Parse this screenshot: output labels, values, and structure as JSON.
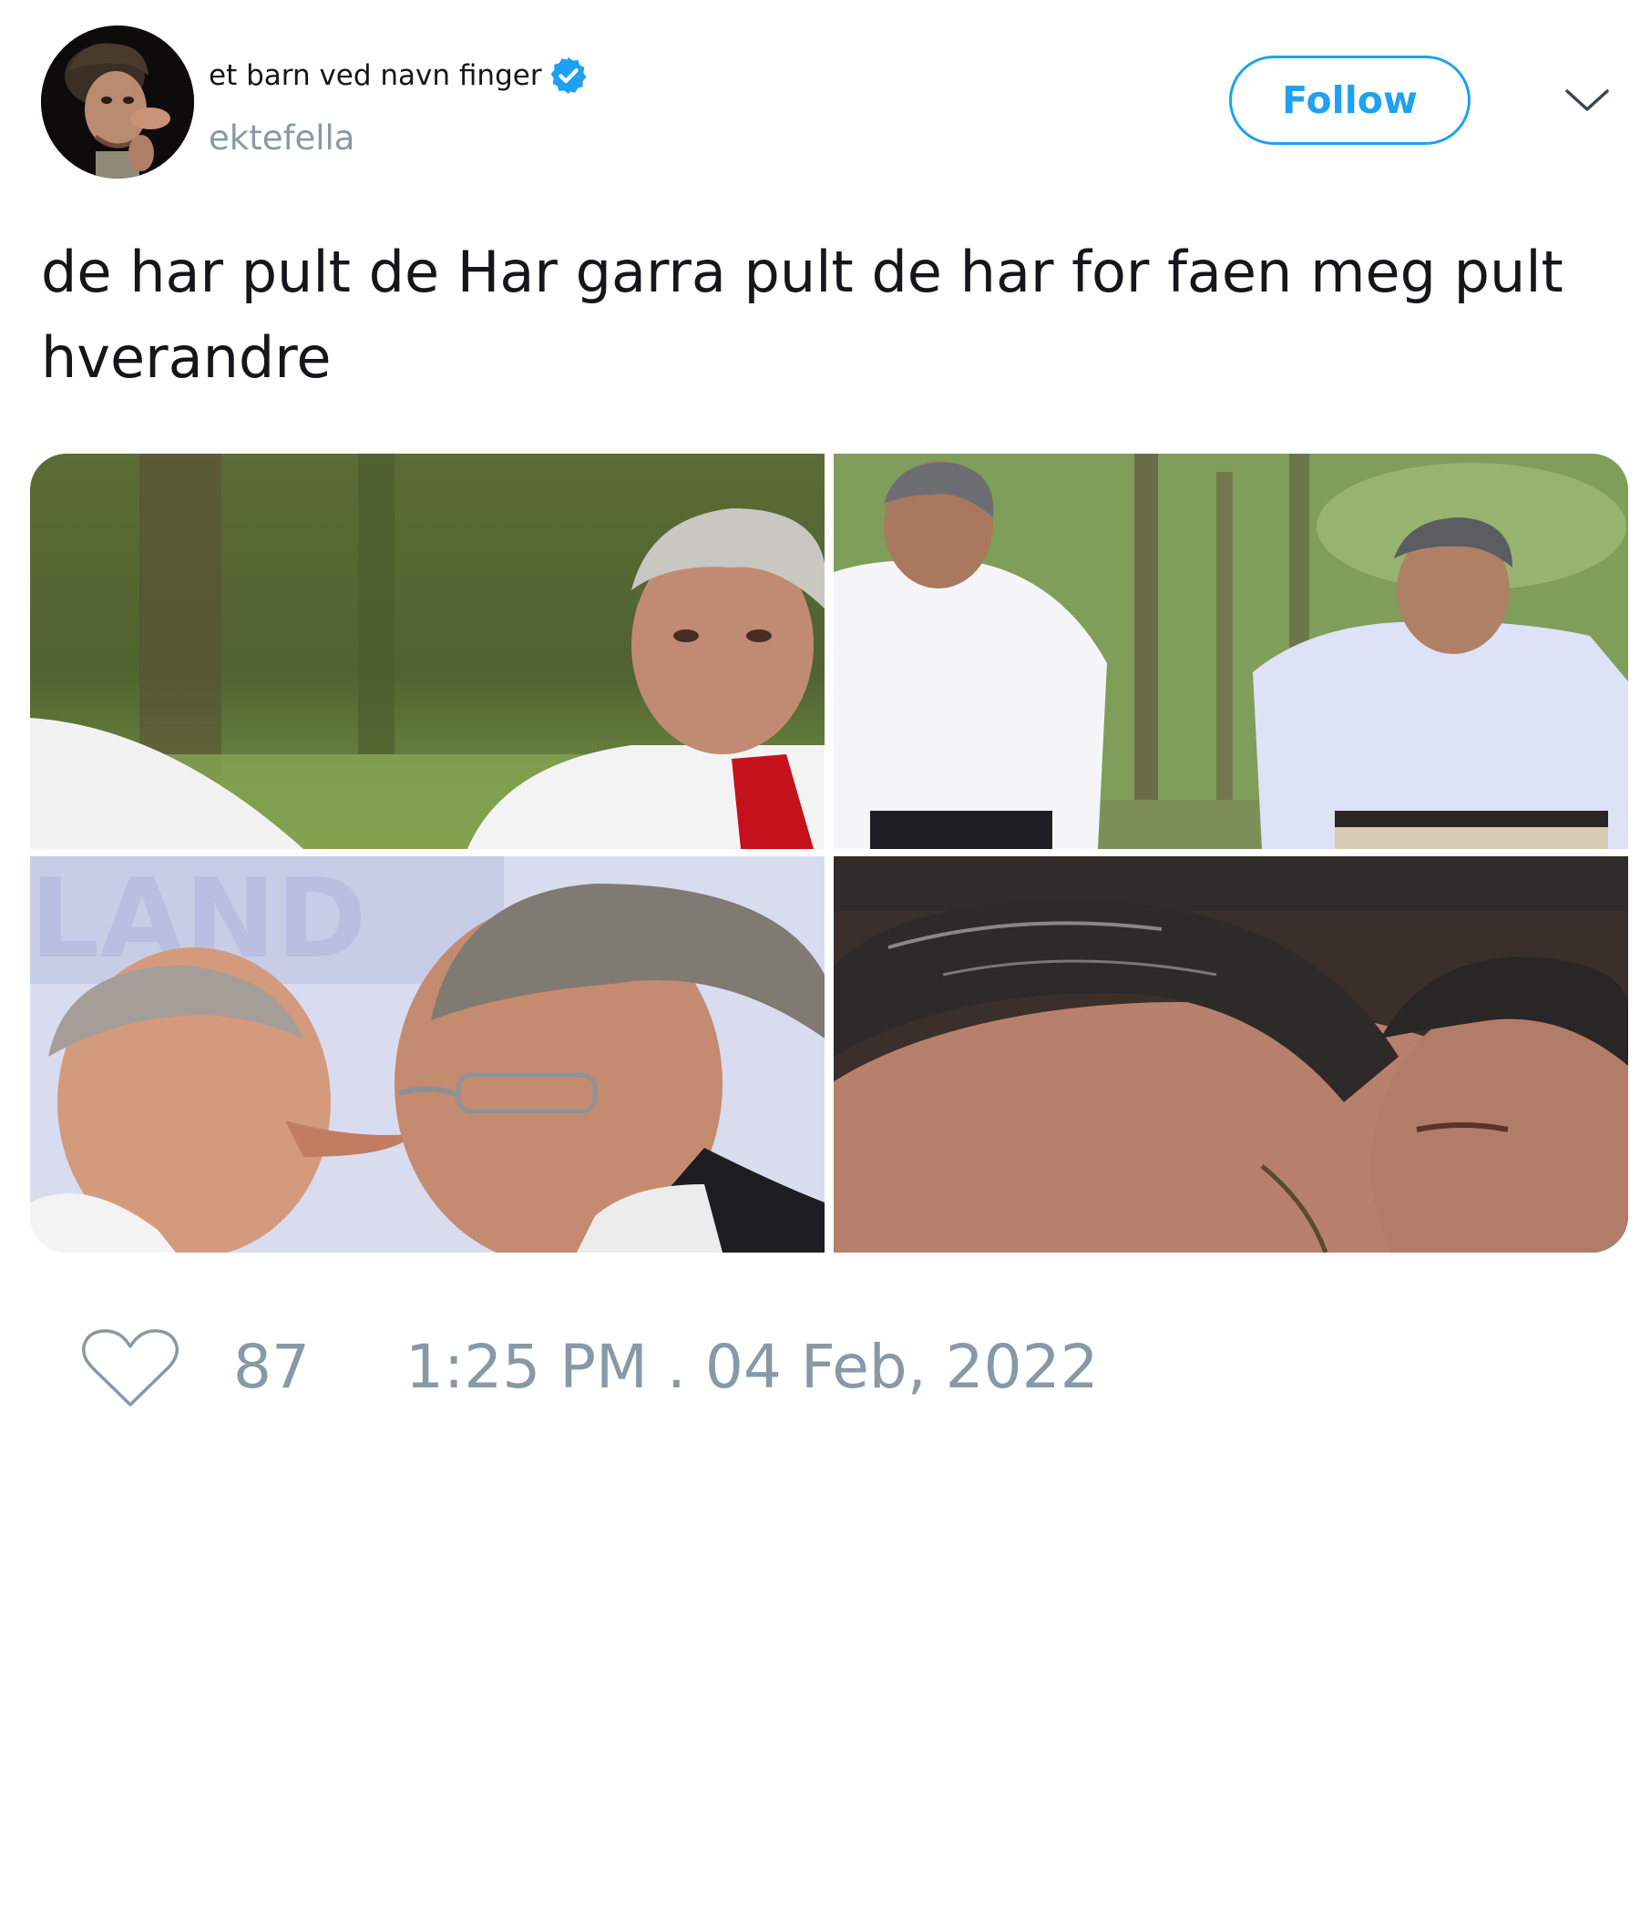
{
  "author": {
    "display_name": "et barn ved navn finger",
    "username": "ektefella",
    "verified": true,
    "verified_icon": "verified-badge-icon",
    "avatar": "caricature-avatar"
  },
  "header": {
    "follow_label": "Follow",
    "menu_icon": "chevron-down-icon"
  },
  "tweet": {
    "text": "de har pult de Har garra pult de har for faen meg pult hverandre"
  },
  "media": [
    {
      "description_icon": "photo-grey-haired-man-red-tie"
    },
    {
      "description_icon": "photo-two-men-walking-in-woods"
    },
    {
      "description_icon": "photo-two-men-face-to-face"
    },
    {
      "description_icon": "photo-closeup-dark-hair"
    }
  ],
  "footer": {
    "like_icon": "heart-icon",
    "like_count": "87",
    "timestamp": "1:25 PM . 04 Feb, 2022"
  },
  "colors": {
    "accent": "#1da1f2",
    "muted_text": "#8899a6",
    "primary_text": "#14171a"
  }
}
